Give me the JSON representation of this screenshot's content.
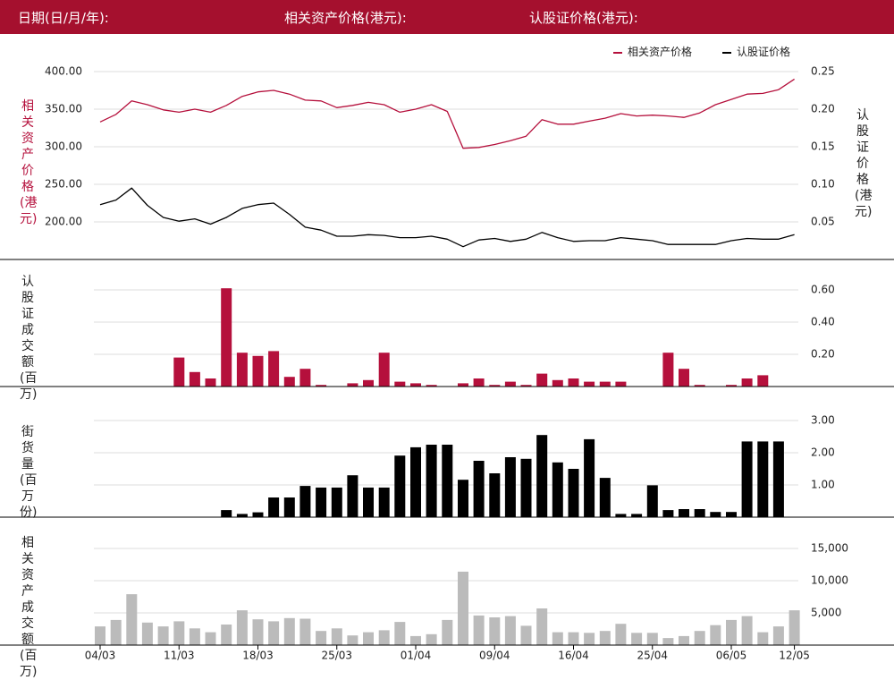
{
  "header": {
    "date_label": "日期(日/月/年):",
    "asset_price_label": "相关资产价格(港元):",
    "warrant_price_label": "认股证价格(港元):"
  },
  "colors": {
    "header_bg": "#a5102e",
    "asset_line": "#b5103c",
    "warrant_line": "#000000",
    "warrant_turnover_bar": "#b5103c",
    "outstanding_bar": "#000000",
    "asset_turnover_bar": "#bbbbbb",
    "grid": "#dddddd"
  },
  "chart_data": [
    {
      "type": "line",
      "series": [
        {
          "name": "相关资产价格",
          "axis": "left",
          "values": [
            333,
            343,
            361,
            356,
            349,
            346,
            350,
            346,
            355,
            367,
            373,
            375,
            370,
            362,
            361,
            352,
            355,
            359,
            356,
            346,
            350,
            356,
            347,
            298,
            299,
            303,
            308,
            314,
            336,
            330,
            330,
            334,
            338,
            344,
            341,
            342,
            341,
            339,
            345,
            356,
            363,
            370,
            371,
            376,
            390
          ]
        },
        {
          "name": "认股证价格",
          "axis": "right",
          "values": [
            0.073,
            0.079,
            0.095,
            0.072,
            0.056,
            0.051,
            0.054,
            0.047,
            0.056,
            0.068,
            0.073,
            0.075,
            0.06,
            0.043,
            0.039,
            0.031,
            0.031,
            0.033,
            0.032,
            0.029,
            0.029,
            0.031,
            0.027,
            0.017,
            0.026,
            0.028,
            0.024,
            0.027,
            0.036,
            0.029,
            0.024,
            0.025,
            0.025,
            0.029,
            0.027,
            0.025,
            0.02,
            0.02,
            0.02,
            0.02,
            0.025,
            0.028,
            0.027,
            0.027,
            0.033
          ]
        }
      ],
      "y_left_label": "相关资产价格(港元)",
      "y_right_label": "认股证价格(港元)",
      "y_left_ticks": [
        "400.00",
        "350.00",
        "300.00",
        "250.00",
        "200.00"
      ],
      "y_right_ticks": [
        "0.25",
        "0.20",
        "0.15",
        "0.10",
        "0.05"
      ],
      "y_left_lim": [
        150,
        400
      ],
      "y_right_lim": [
        0,
        0.25
      ],
      "grid": true,
      "legend": "top-right"
    },
    {
      "type": "bar",
      "name": "认股证成交额",
      "y_label": "认股证成交额(百万)",
      "values": [
        0,
        0,
        0,
        0,
        0,
        0.18,
        0.09,
        0.05,
        0.61,
        0.21,
        0.19,
        0.22,
        0.06,
        0.11,
        0.01,
        0,
        0.02,
        0.04,
        0.21,
        0.03,
        0.02,
        0.01,
        0,
        0.02,
        0.05,
        0.01,
        0.03,
        0.01,
        0.08,
        0.04,
        0.05,
        0.03,
        0.03,
        0.03,
        0,
        0,
        0.21,
        0.11,
        0.01,
        0,
        0.01,
        0.05,
        0.07,
        0,
        0
      ],
      "y_ticks": [
        "0.60",
        "0.40",
        "0.20"
      ],
      "y_lim": [
        0,
        0.6
      ],
      "grid": true
    },
    {
      "type": "bar",
      "name": "街货量",
      "y_label": "街货量(百万份)",
      "values": [
        0,
        0,
        0,
        0,
        0,
        0,
        0,
        0,
        0.22,
        0.1,
        0.15,
        0.61,
        0.61,
        0.97,
        0.92,
        0.92,
        1.3,
        0.92,
        0.92,
        1.91,
        2.17,
        2.25,
        2.25,
        1.16,
        1.75,
        1.36,
        1.86,
        1.81,
        2.55,
        1.7,
        1.5,
        2.42,
        1.22,
        0.1,
        0.1,
        0.99,
        0.22,
        0.25,
        0.25,
        0.16,
        0.16,
        2.35,
        2.35,
        2.35,
        0
      ],
      "y_ticks": [
        "3.00",
        "2.00",
        "1.00"
      ],
      "y_lim": [
        0,
        3
      ],
      "grid": true
    },
    {
      "type": "bar",
      "name": "相关资产成交额",
      "y_label": "相关资产成交额(百万)",
      "values": [
        2900,
        3900,
        7900,
        3500,
        2900,
        3700,
        2600,
        2000,
        3200,
        5400,
        4000,
        3700,
        4200,
        4100,
        2200,
        2600,
        1500,
        2000,
        2300,
        3600,
        1400,
        1700,
        3900,
        11400,
        4600,
        4300,
        4500,
        3000,
        5700,
        2000,
        2000,
        1900,
        2200,
        3300,
        1900,
        1900,
        1100,
        1400,
        2200,
        3100,
        3900,
        4500,
        2000,
        2900,
        5400
      ],
      "y_ticks": [
        "15,000",
        "10,000",
        "5,000"
      ],
      "y_lim": [
        0,
        15000
      ],
      "grid": true
    }
  ],
  "x_axis": {
    "tick_labels": [
      "04/03",
      "11/03",
      "18/03",
      "25/03",
      "01/04",
      "09/04",
      "16/04",
      "25/04",
      "06/05",
      "12/05"
    ],
    "tick_indices": [
      0,
      5,
      10,
      15,
      20,
      25,
      30,
      35,
      40,
      44
    ]
  }
}
